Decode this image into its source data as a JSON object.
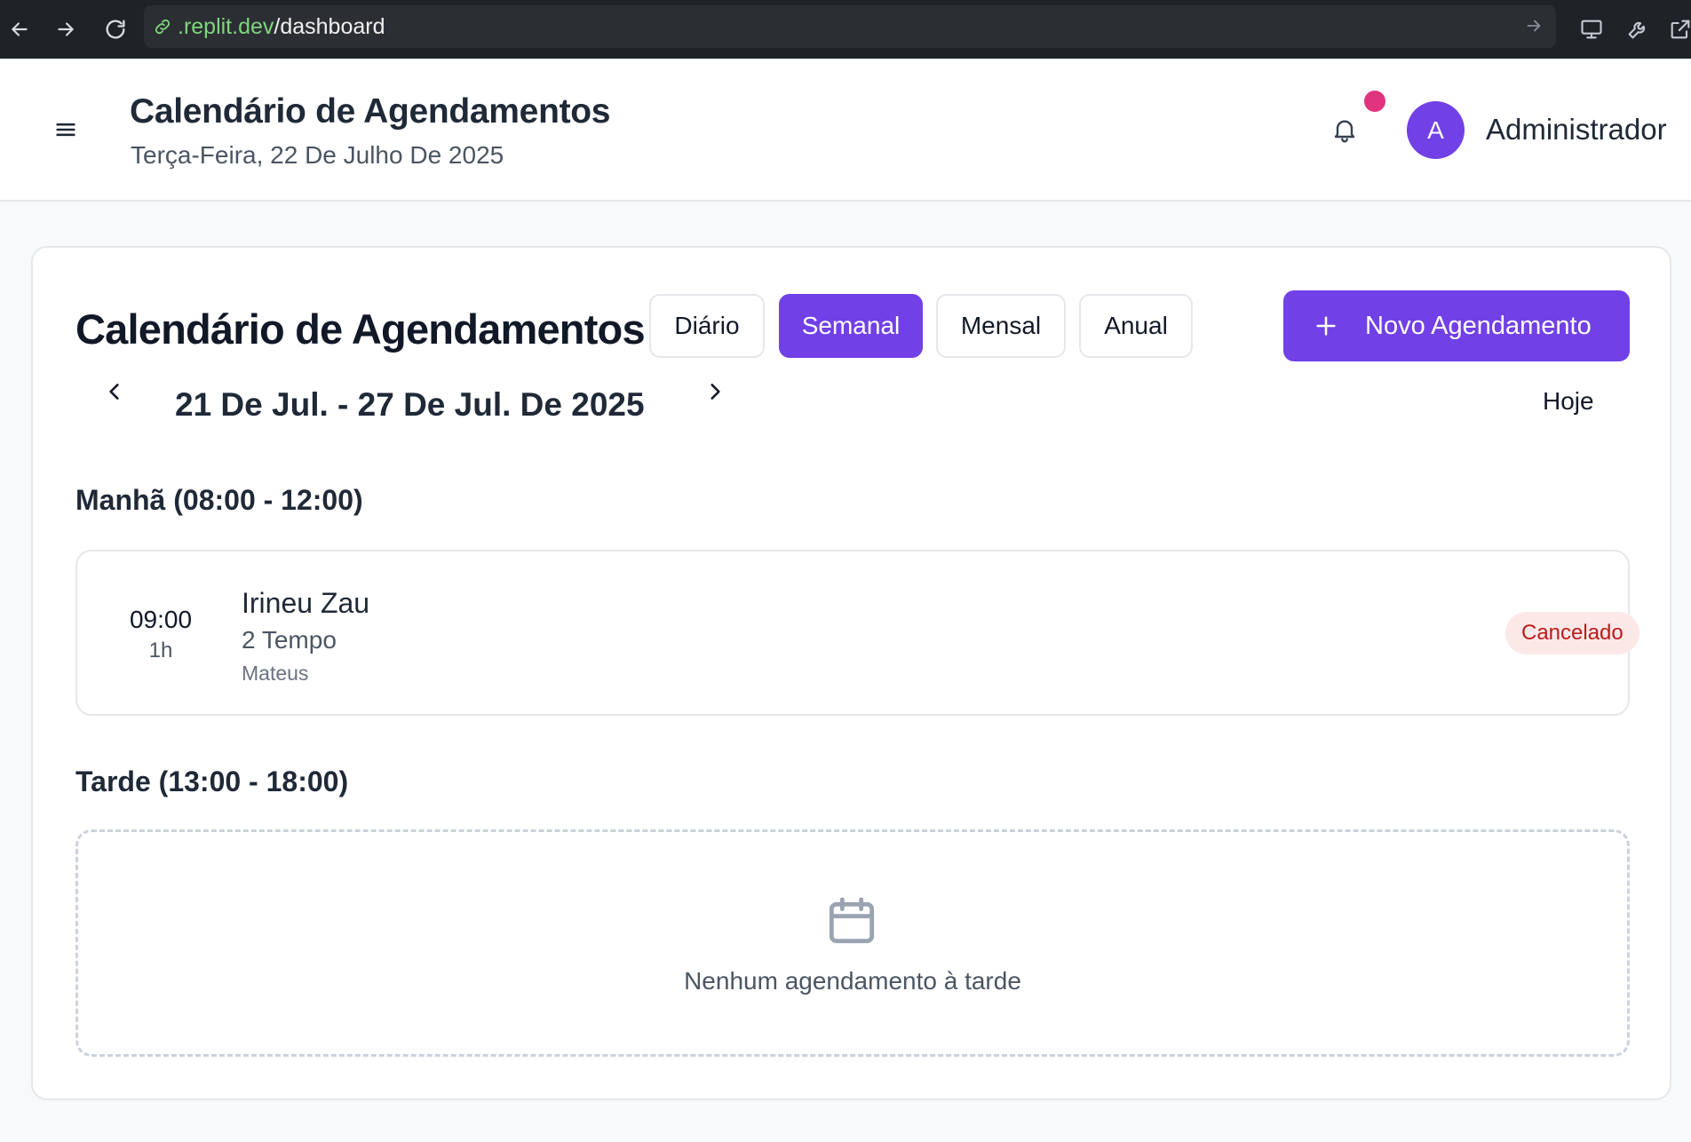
{
  "browser": {
    "url_host": ".replit.dev",
    "url_path": "/dashboard"
  },
  "header": {
    "title": "Calendário de Agendamentos",
    "subtitle": "Terça-Feira, 22 De Julho De 2025",
    "avatar_initial": "A",
    "user_name": "Administrador",
    "notification_dot_color": "#e0347f"
  },
  "calendar": {
    "title": "Calendário de Agendamentos",
    "views": [
      "Diário",
      "Semanal",
      "Mensal",
      "Anual"
    ],
    "active_view": "Semanal",
    "new_button_label": "Novo Agendamento",
    "range_label": "21 De Jul. - 27 De Jul. De 2025",
    "today_label": "Hoje",
    "accent_color": "#7140e6"
  },
  "sections": {
    "morning": {
      "title": "Manhã (08:00 - 12:00)",
      "appointments": [
        {
          "time": "09:00",
          "duration": "1h",
          "client": "Irineu Zau",
          "service": "2 Tempo",
          "staff": "Mateus",
          "status": "Cancelado",
          "status_color": "#b91c1c"
        }
      ]
    },
    "afternoon": {
      "title": "Tarde (13:00 - 18:00)",
      "empty_message": "Nenhum agendamento à tarde"
    }
  }
}
